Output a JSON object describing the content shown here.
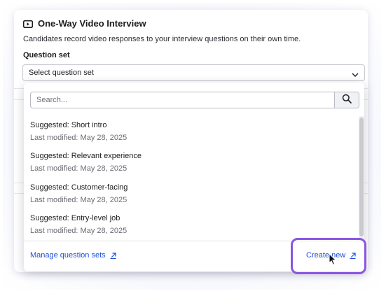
{
  "panel": {
    "title": "One-Way Video Interview",
    "description": "Candidates record video responses to your interview questions on their own time.",
    "question_set_label": "Question set",
    "select_value": "Select question set"
  },
  "dropdown": {
    "search_placeholder": "Search...",
    "options": [
      {
        "name": "Suggested: Short intro",
        "meta": "Last modified: May 28, 2025"
      },
      {
        "name": "Suggested: Relevant experience",
        "meta": "Last modified: May 28, 2025"
      },
      {
        "name": "Suggested: Customer-facing",
        "meta": "Last modified: May 28, 2025"
      },
      {
        "name": "Suggested: Entry-level job",
        "meta": "Last modified: May 28, 2025"
      }
    ],
    "manage_link": "Manage question sets",
    "create_link": "Create new"
  },
  "colors": {
    "link": "#1d4fd8",
    "highlight": "#8a56e0"
  },
  "icons": [
    "video-icon",
    "chevron-down-icon",
    "search-icon",
    "external-link-icon",
    "cursor-icon"
  ]
}
